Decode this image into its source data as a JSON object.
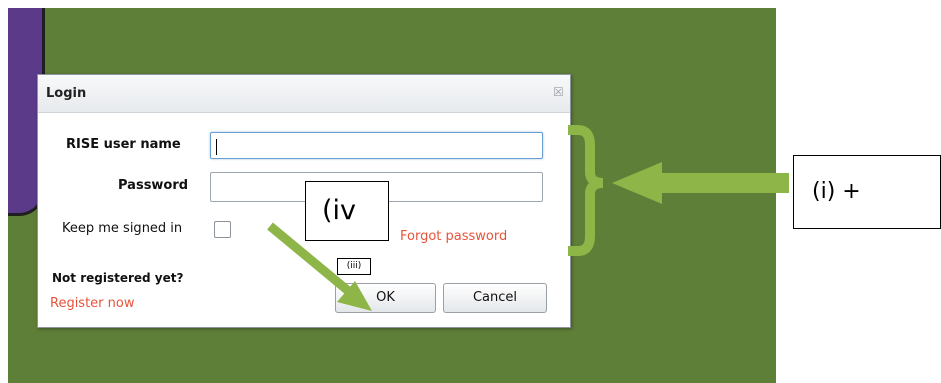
{
  "dialog": {
    "title": "Login",
    "username_label": "RISE user name",
    "username_value": "",
    "password_label": "Password",
    "password_value": "",
    "keep_signed_in_label": "Keep me signed in",
    "keep_signed_in_checked": false,
    "forgot_password": "Forgot password",
    "not_registered": "Not registered yet?",
    "register_now": "Register now",
    "ok_label": "OK",
    "cancel_label": "Cancel"
  },
  "annotations": {
    "label_i": "(i) +",
    "label_iv": "(iv",
    "label_iii": "(iii)"
  },
  "colors": {
    "background_green": "#5e7f38",
    "purple_panel": "#5b3a8a",
    "annotation_green": "#8db547",
    "link_orange": "#e8533a"
  }
}
